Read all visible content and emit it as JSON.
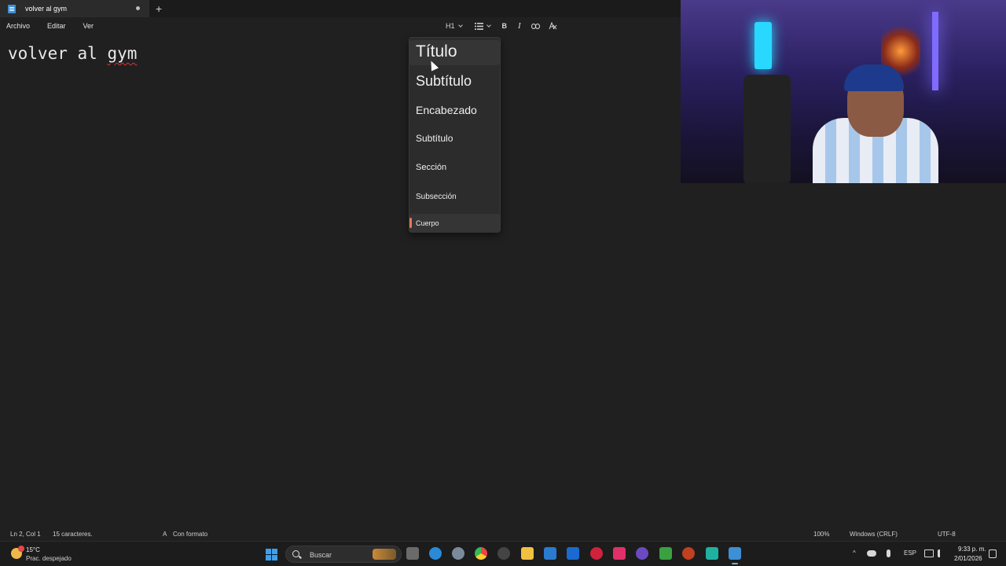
{
  "tab": {
    "title": "volver al gym",
    "new_tab": "+"
  },
  "menu": {
    "items": [
      "Archivo",
      "Editar",
      "Ver"
    ]
  },
  "toolbar": {
    "heading": "H1",
    "bold": "B",
    "italic": "I"
  },
  "editor": {
    "word1": "volver al ",
    "word2": "gym"
  },
  "dropdown": {
    "items": [
      {
        "label": "Título"
      },
      {
        "label": "Subtítulo"
      },
      {
        "label": "Encabezado"
      },
      {
        "label": "Subtítulo"
      },
      {
        "label": "Sección"
      },
      {
        "label": "Subsección"
      },
      {
        "label": "Cuerpo"
      }
    ],
    "selected_index": 6,
    "accent": "#e07a5f"
  },
  "status": {
    "position": "Ln 2, Col 1",
    "chars": "15 caracteres.",
    "format": "Con formato",
    "zoom": "100%",
    "line_ending": "Windows (CRLF)",
    "encoding": "UTF-8"
  },
  "taskbar": {
    "temp": "15°C",
    "condition": "Prac. despejado",
    "search_placeholder": "Buscar",
    "lang": "ESP",
    "time": "9:33 p. m.",
    "date": "2/01/2026"
  }
}
